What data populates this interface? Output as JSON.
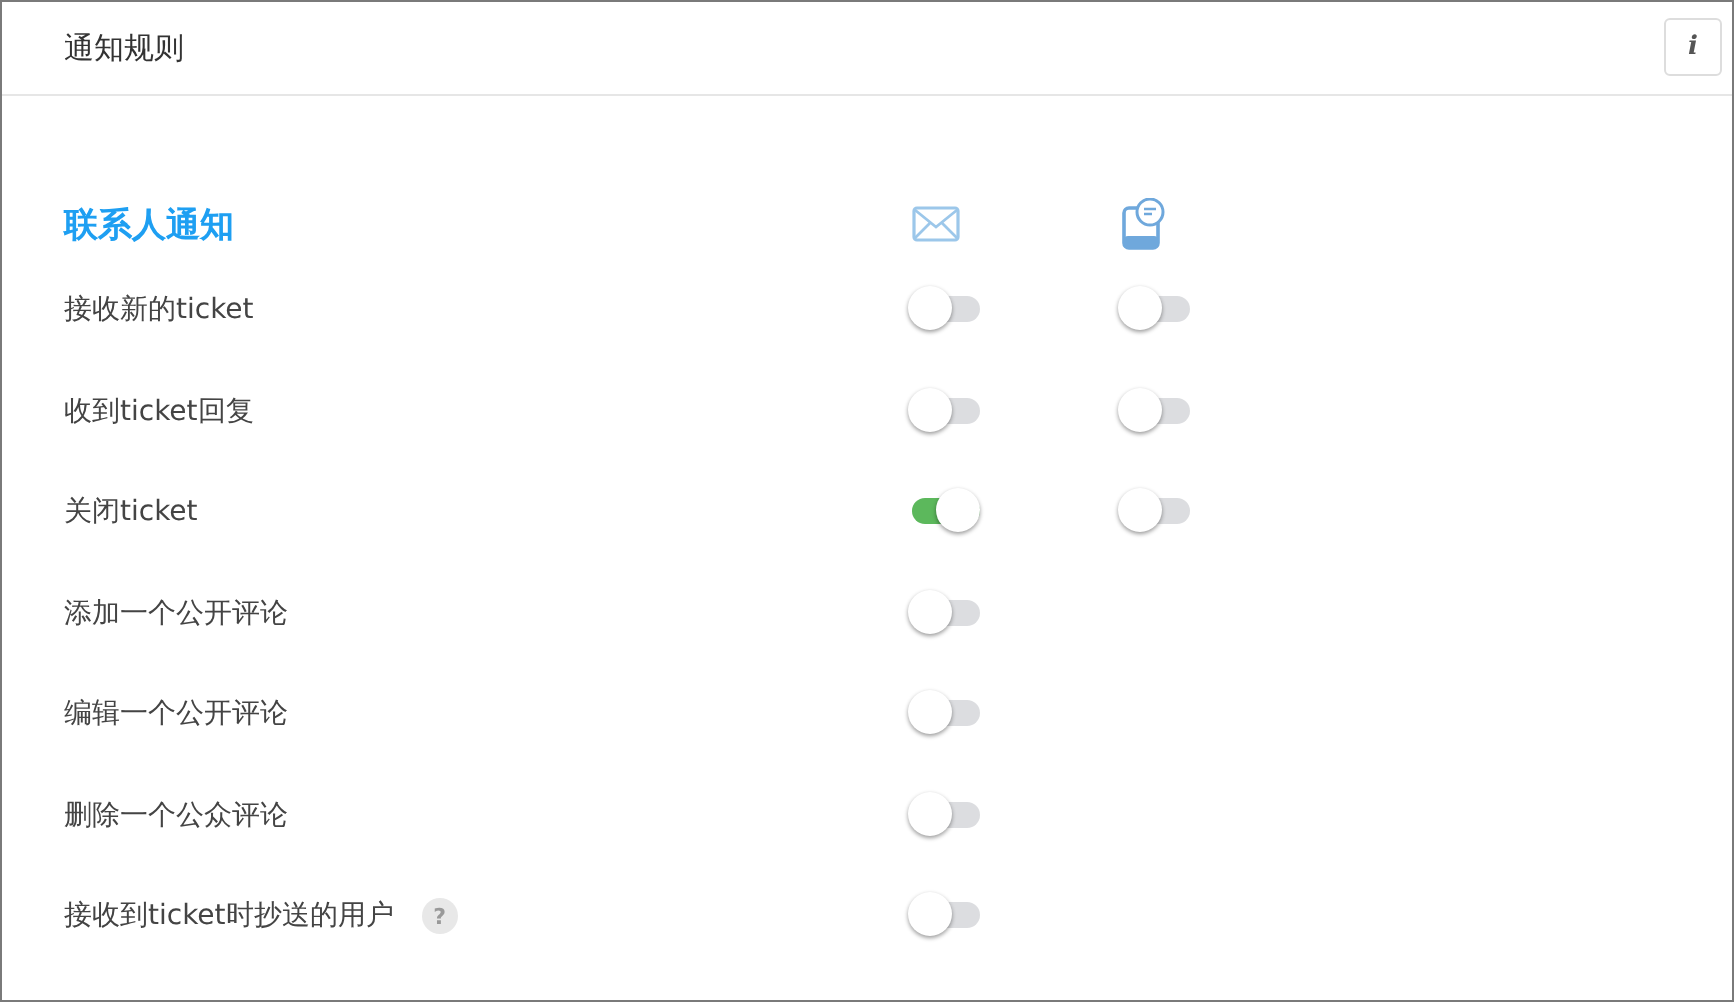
{
  "header": {
    "title": "通知规则",
    "info_button": "i"
  },
  "section": {
    "title": "联系人通知"
  },
  "rows": [
    {
      "label": "接收新的ticket",
      "email_on": false,
      "sms_on": false
    },
    {
      "label": "收到ticket回复",
      "email_on": false,
      "sms_on": false
    },
    {
      "label": "关闭ticket",
      "email_on": true,
      "sms_on": false
    },
    {
      "label": "添加一个公开评论",
      "email_on": false
    },
    {
      "label": "编辑一个公开评论",
      "email_on": false
    },
    {
      "label": "删除一个公众评论",
      "email_on": false
    },
    {
      "label": "接收到ticket时抄送的用户",
      "help": "?",
      "email_on": false
    }
  ]
}
